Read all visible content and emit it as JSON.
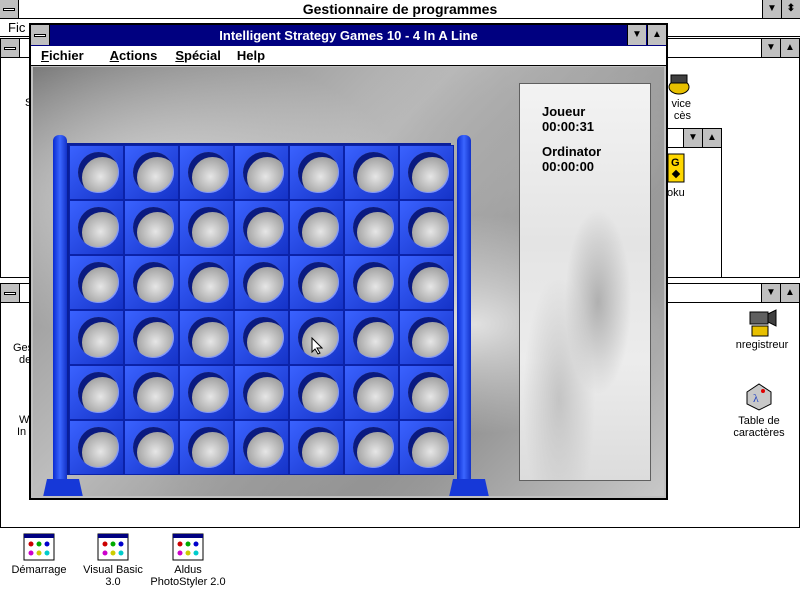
{
  "program_manager": {
    "title": "Gestionnaire de programmes",
    "menu_fragment": "Fic",
    "groups": [
      {
        "icons": [
          {
            "label_line1": "vice",
            "label_line2": "cès",
            "icon": "service-access-icon"
          }
        ]
      },
      {
        "icons": [
          {
            "label": "oku",
            "icon": "sudoku-icon"
          }
        ]
      },
      {
        "icons": [
          {
            "label_line1": "Ges",
            "label_line2": "de",
            "icon": "partial-text"
          },
          {
            "label_line1": "W",
            "label_line2": "In",
            "icon": "partial-text"
          },
          {
            "label": "nregistreur",
            "icon": "sound-recorder-icon"
          },
          {
            "label_line1": "Table de",
            "label_line2": "caractères",
            "icon": "character-map-icon"
          }
        ]
      }
    ],
    "side_text": {
      "s_left": "S"
    },
    "bottom_icons": [
      {
        "label_line1": "Démarrage",
        "label_line2": "",
        "icon": "program-group-icon"
      },
      {
        "label_line1": "Visual Basic",
        "label_line2": "3.0",
        "icon": "program-group-icon"
      },
      {
        "label_line1": "Aldus",
        "label_line2": "PhotoStyler 2.0",
        "icon": "program-group-icon"
      }
    ]
  },
  "game_window": {
    "title": "Intelligent Strategy Games 10 - 4 In A Line",
    "menus": [
      {
        "label": "Fichier",
        "underline": "F",
        "rest": "ichier"
      },
      {
        "label": "Actions",
        "underline": "A",
        "rest": "ctions"
      },
      {
        "label": "Spécial",
        "underline": "S",
        "rest": "pécial"
      },
      {
        "label": "Help",
        "underline": "",
        "rest": "Help"
      }
    ],
    "board": {
      "columns": 7,
      "rows": 6
    },
    "score": {
      "player_label": "Joueur",
      "player_time": "00:00:31",
      "computer_label": "Ordinator",
      "computer_time": "00:00:00"
    }
  },
  "colors": {
    "titlebar_active": "#000080",
    "board_blue": "#1f3fe0",
    "window_bg": "#c0c0c0"
  }
}
